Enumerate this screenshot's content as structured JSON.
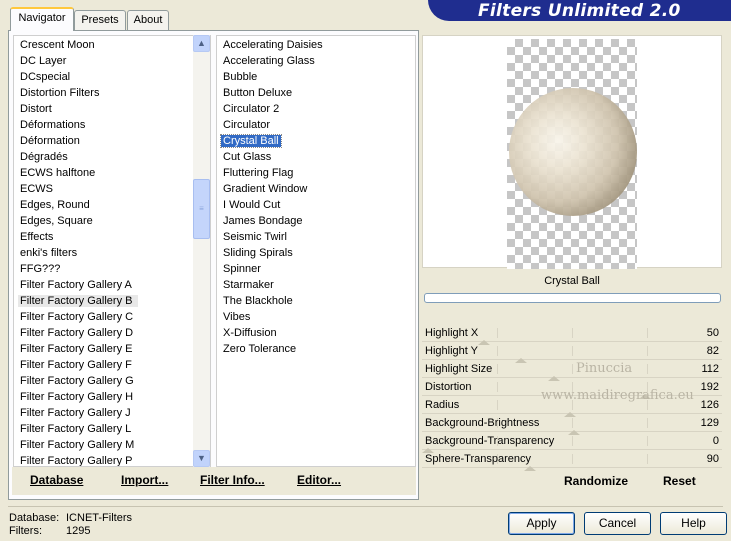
{
  "banner": {
    "title": "Filters Unlimited 2.0"
  },
  "tabs": [
    {
      "label": "Navigator",
      "active": true
    },
    {
      "label": "Presets",
      "active": false
    },
    {
      "label": "About",
      "active": false
    }
  ],
  "categories": [
    "Crescent Moon",
    "DC Layer",
    "DCspecial",
    "Distortion Filters",
    "Distort",
    "Déformations",
    "Déformation",
    "Dégradés",
    "ECWS halftone",
    "ECWS",
    "Edges, Round",
    "Edges, Square",
    "Effects",
    "enki's filters",
    "FFG???",
    "Filter Factory Gallery A",
    "Filter Factory Gallery B",
    "Filter Factory Gallery C",
    "Filter Factory Gallery D",
    "Filter Factory Gallery E",
    "Filter Factory Gallery F",
    "Filter Factory Gallery G",
    "Filter Factory Gallery H",
    "Filter Factory Gallery J",
    "Filter Factory Gallery L",
    "Filter Factory Gallery M",
    "Filter Factory Gallery P"
  ],
  "selected_category": "Filter Factory Gallery B",
  "filters": [
    "Accelerating Daisies",
    "Accelerating Glass",
    "Bubble",
    "Button Deluxe",
    "Circulator 2",
    "Circulator",
    "Crystal Ball",
    "Cut Glass",
    "Fluttering Flag",
    "Gradient Window",
    "I Would Cut",
    "James Bondage",
    "Seismic Twirl",
    "Sliding Spirals",
    "Spinner",
    "Starmaker",
    "The Blackhole",
    "Vibes",
    "X-Diffusion",
    "Zero Tolerance"
  ],
  "selected_filter": "Crystal Ball",
  "commands": {
    "database": "Database",
    "import": "Import...",
    "filter_info": "Filter Info...",
    "editor": "Editor..."
  },
  "preview": {
    "filter_name": "Crystal Ball"
  },
  "params": [
    {
      "label": "Highlight X",
      "value": "50"
    },
    {
      "label": "Highlight Y",
      "value": "82"
    },
    {
      "label": "Highlight Size",
      "value": "112"
    },
    {
      "label": "Distortion",
      "value": "192"
    },
    {
      "label": "Radius",
      "value": "126"
    },
    {
      "label": "Background-Brightness",
      "value": "129"
    },
    {
      "label": "Background-Transparency",
      "value": "0"
    },
    {
      "label": "Sphere-Transparency",
      "value": "90"
    }
  ],
  "watermark": {
    "line1": "Pinuccia",
    "line2": "www.maidiregrafica.eu"
  },
  "right_buttons": {
    "randomize": "Randomize",
    "reset": "Reset"
  },
  "status": {
    "database_label": "Database:",
    "database_value": "ICNET-Filters",
    "filters_label": "Filters:",
    "filters_value": "1295"
  },
  "dialog_buttons": {
    "apply": "Apply",
    "cancel": "Cancel",
    "help": "Help"
  },
  "colors": {
    "banner": "#1f2d8f",
    "selection": "#316ac5",
    "tab_highlight": "#ffc83c"
  }
}
